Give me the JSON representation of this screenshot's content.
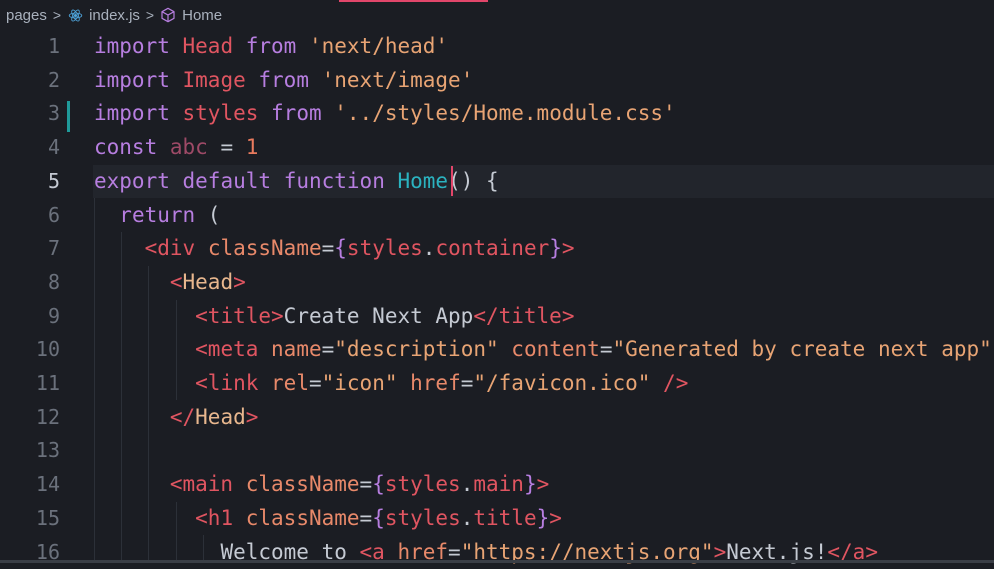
{
  "breadcrumb": {
    "items": [
      {
        "label": "pages",
        "icon": null
      },
      {
        "label": "index.js",
        "icon": "react-icon"
      },
      {
        "label": "Home",
        "icon": "symbol-class-icon"
      }
    ],
    "separator": ">"
  },
  "editor": {
    "current_line": 5,
    "modified_line": 4,
    "lines": [
      {
        "n": "1",
        "tokens": [
          [
            "kw",
            "import"
          ],
          [
            "op",
            " "
          ],
          [
            "imp",
            "Head"
          ],
          [
            "op",
            " "
          ],
          [
            "kw",
            "from"
          ],
          [
            "op",
            " "
          ],
          [
            "str",
            "'next/head'"
          ]
        ]
      },
      {
        "n": "2",
        "tokens": [
          [
            "kw",
            "import"
          ],
          [
            "op",
            " "
          ],
          [
            "imp",
            "Image"
          ],
          [
            "op",
            " "
          ],
          [
            "kw",
            "from"
          ],
          [
            "op",
            " "
          ],
          [
            "str",
            "'next/image'"
          ]
        ]
      },
      {
        "n": "3",
        "tokens": [
          [
            "kw",
            "import"
          ],
          [
            "op",
            " "
          ],
          [
            "imp",
            "styles"
          ],
          [
            "op",
            " "
          ],
          [
            "kw",
            "from"
          ],
          [
            "op",
            " "
          ],
          [
            "str",
            "'../styles/Home.module.css'"
          ]
        ]
      },
      {
        "n": "4",
        "tokens": [
          [
            "kw",
            "const"
          ],
          [
            "op",
            " "
          ],
          [
            "var",
            "abc"
          ],
          [
            "op",
            " = "
          ],
          [
            "num",
            "1"
          ]
        ]
      },
      {
        "n": "5",
        "tokens": [
          [
            "kw",
            "export"
          ],
          [
            "op",
            " "
          ],
          [
            "kw",
            "default"
          ],
          [
            "op",
            " "
          ],
          [
            "kw",
            "function"
          ],
          [
            "op",
            " "
          ],
          [
            "fn",
            "Home"
          ],
          [
            "pun",
            "() {"
          ]
        ]
      },
      {
        "n": "6",
        "tokens": [
          [
            "op",
            "  "
          ],
          [
            "kw",
            "return"
          ],
          [
            "pun",
            " ("
          ]
        ]
      },
      {
        "n": "7",
        "tokens": [
          [
            "op",
            "    "
          ],
          [
            "tag",
            "<div"
          ],
          [
            "op",
            " "
          ],
          [
            "attr",
            "className"
          ],
          [
            "pun",
            "="
          ],
          [
            "brace",
            "{"
          ],
          [
            "imp",
            "styles"
          ],
          [
            "pun",
            "."
          ],
          [
            "imp",
            "container"
          ],
          [
            "brace",
            "}"
          ],
          [
            "tag",
            ">"
          ]
        ]
      },
      {
        "n": "8",
        "tokens": [
          [
            "op",
            "      "
          ],
          [
            "tag",
            "<"
          ],
          [
            "comp",
            "Head"
          ],
          [
            "tag",
            ">"
          ]
        ]
      },
      {
        "n": "9",
        "tokens": [
          [
            "op",
            "        "
          ],
          [
            "tag",
            "<title>"
          ],
          [
            "txt",
            "Create Next App"
          ],
          [
            "tag",
            "</title>"
          ]
        ]
      },
      {
        "n": "10",
        "tokens": [
          [
            "op",
            "        "
          ],
          [
            "tag",
            "<meta"
          ],
          [
            "op",
            " "
          ],
          [
            "attr",
            "name"
          ],
          [
            "pun",
            "="
          ],
          [
            "str",
            "\"description\""
          ],
          [
            "op",
            " "
          ],
          [
            "attr",
            "content"
          ],
          [
            "pun",
            "="
          ],
          [
            "str",
            "\"Generated by create next app\""
          ]
        ]
      },
      {
        "n": "11",
        "tokens": [
          [
            "op",
            "        "
          ],
          [
            "tag",
            "<link"
          ],
          [
            "op",
            " "
          ],
          [
            "attr",
            "rel"
          ],
          [
            "pun",
            "="
          ],
          [
            "str",
            "\"icon\""
          ],
          [
            "op",
            " "
          ],
          [
            "attr",
            "href"
          ],
          [
            "pun",
            "="
          ],
          [
            "str",
            "\"/favicon.ico\""
          ],
          [
            "op",
            " "
          ],
          [
            "tag",
            "/>"
          ]
        ]
      },
      {
        "n": "12",
        "tokens": [
          [
            "op",
            "      "
          ],
          [
            "tag",
            "</"
          ],
          [
            "comp",
            "Head"
          ],
          [
            "tag",
            ">"
          ]
        ]
      },
      {
        "n": "13",
        "tokens": []
      },
      {
        "n": "14",
        "tokens": [
          [
            "op",
            "      "
          ],
          [
            "tag",
            "<main"
          ],
          [
            "op",
            " "
          ],
          [
            "attr",
            "className"
          ],
          [
            "pun",
            "="
          ],
          [
            "brace",
            "{"
          ],
          [
            "imp",
            "styles"
          ],
          [
            "pun",
            "."
          ],
          [
            "imp",
            "main"
          ],
          [
            "brace",
            "}"
          ],
          [
            "tag",
            ">"
          ]
        ]
      },
      {
        "n": "15",
        "tokens": [
          [
            "op",
            "        "
          ],
          [
            "tag",
            "<h1"
          ],
          [
            "op",
            " "
          ],
          [
            "attr",
            "className"
          ],
          [
            "pun",
            "="
          ],
          [
            "brace",
            "{"
          ],
          [
            "imp",
            "styles"
          ],
          [
            "pun",
            "."
          ],
          [
            "imp",
            "title"
          ],
          [
            "brace",
            "}"
          ],
          [
            "tag",
            ">"
          ]
        ]
      },
      {
        "n": "16",
        "tokens": [
          [
            "op",
            "          "
          ],
          [
            "txt",
            "Welcome to "
          ],
          [
            "tag",
            "<a"
          ],
          [
            "op",
            " "
          ],
          [
            "attr",
            "href"
          ],
          [
            "pun",
            "="
          ],
          [
            "str",
            "\"https://nextjs.org\""
          ],
          [
            "tag",
            ">"
          ],
          [
            "txt",
            "Next.js!"
          ],
          [
            "tag",
            "</a>"
          ]
        ]
      }
    ]
  }
}
